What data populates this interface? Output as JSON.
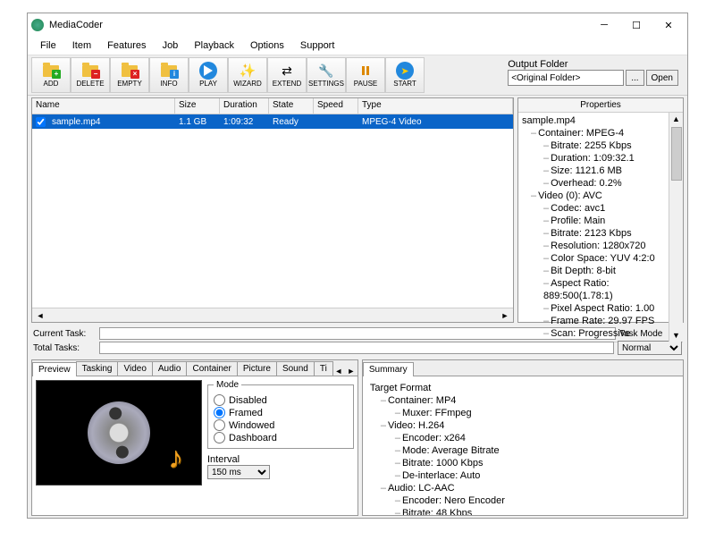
{
  "title": "MediaCoder",
  "menu": [
    "File",
    "Item",
    "Features",
    "Job",
    "Playback",
    "Options",
    "Support"
  ],
  "toolbar": [
    {
      "id": "add",
      "label": "ADD"
    },
    {
      "id": "delete",
      "label": "DELETE"
    },
    {
      "id": "empty",
      "label": "EMPTY"
    },
    {
      "id": "info",
      "label": "INFO"
    },
    {
      "id": "play",
      "label": "PLAY"
    },
    {
      "id": "wizard",
      "label": "WIZARD"
    },
    {
      "id": "extend",
      "label": "EXTEND"
    },
    {
      "id": "settings",
      "label": "SETTINGS"
    },
    {
      "id": "pause",
      "label": "PAUSE"
    },
    {
      "id": "start",
      "label": "START"
    }
  ],
  "output_folder": {
    "label": "Output Folder",
    "value": "<Original Folder>",
    "browse": "...",
    "open": "Open"
  },
  "columns": {
    "name": "Name",
    "size": "Size",
    "duration": "Duration",
    "state": "State",
    "speed": "Speed",
    "type": "Type"
  },
  "file": {
    "checked": true,
    "name": "sample.mp4",
    "size": "1.1 GB",
    "duration": "1:09:32",
    "state": "Ready",
    "speed": "",
    "type": "MPEG-4 Video"
  },
  "props_header": "Properties",
  "props": [
    {
      "lvl": 0,
      "t": "sample.mp4"
    },
    {
      "lvl": 1,
      "t": "Container: MPEG-4"
    },
    {
      "lvl": 2,
      "t": "Bitrate: 2255 Kbps"
    },
    {
      "lvl": 2,
      "t": "Duration: 1:09:32.1"
    },
    {
      "lvl": 2,
      "t": "Size: 1121.6 MB"
    },
    {
      "lvl": 2,
      "t": "Overhead: 0.2%"
    },
    {
      "lvl": 1,
      "t": "Video (0): AVC"
    },
    {
      "lvl": 2,
      "t": "Codec: avc1"
    },
    {
      "lvl": 2,
      "t": "Profile: Main"
    },
    {
      "lvl": 2,
      "t": "Bitrate: 2123 Kbps"
    },
    {
      "lvl": 2,
      "t": "Resolution: 1280x720"
    },
    {
      "lvl": 2,
      "t": "Color Space: YUV 4:2:0"
    },
    {
      "lvl": 2,
      "t": "Bit Depth: 8-bit"
    },
    {
      "lvl": 2,
      "t": "Aspect Ratio: 889:500(1.78:1)"
    },
    {
      "lvl": 2,
      "t": "Pixel Aspect Ratio: 1.00"
    },
    {
      "lvl": 2,
      "t": "Frame Rate: 29.97 FPS"
    },
    {
      "lvl": 2,
      "t": "Scan: Progressive"
    }
  ],
  "tasks": {
    "current": "Current Task:",
    "total": "Total Tasks:",
    "mode_label": "Task Mode",
    "mode": "Normal"
  },
  "left_tabs": [
    "Preview",
    "Tasking",
    "Video",
    "Audio",
    "Container",
    "Picture",
    "Sound",
    "Ti"
  ],
  "right_tabs": [
    "Summary"
  ],
  "mode": {
    "legend": "Mode",
    "options": [
      "Disabled",
      "Framed",
      "Windowed",
      "Dashboard"
    ],
    "selected": "Framed"
  },
  "interval": {
    "label": "Interval",
    "value": "150 ms"
  },
  "summary": [
    {
      "lvl": 0,
      "t": "Target Format"
    },
    {
      "lvl": 1,
      "t": "Container: MP4"
    },
    {
      "lvl": 2,
      "t": "Muxer: FFmpeg"
    },
    {
      "lvl": 1,
      "t": "Video: H.264"
    },
    {
      "lvl": 2,
      "t": "Encoder: x264"
    },
    {
      "lvl": 2,
      "t": "Mode: Average Bitrate"
    },
    {
      "lvl": 2,
      "t": "Bitrate: 1000 Kbps"
    },
    {
      "lvl": 2,
      "t": "De-interlace: Auto"
    },
    {
      "lvl": 1,
      "t": "Audio: LC-AAC"
    },
    {
      "lvl": 2,
      "t": "Encoder: Nero Encoder"
    },
    {
      "lvl": 2,
      "t": "Bitrate: 48 Kbps"
    }
  ]
}
